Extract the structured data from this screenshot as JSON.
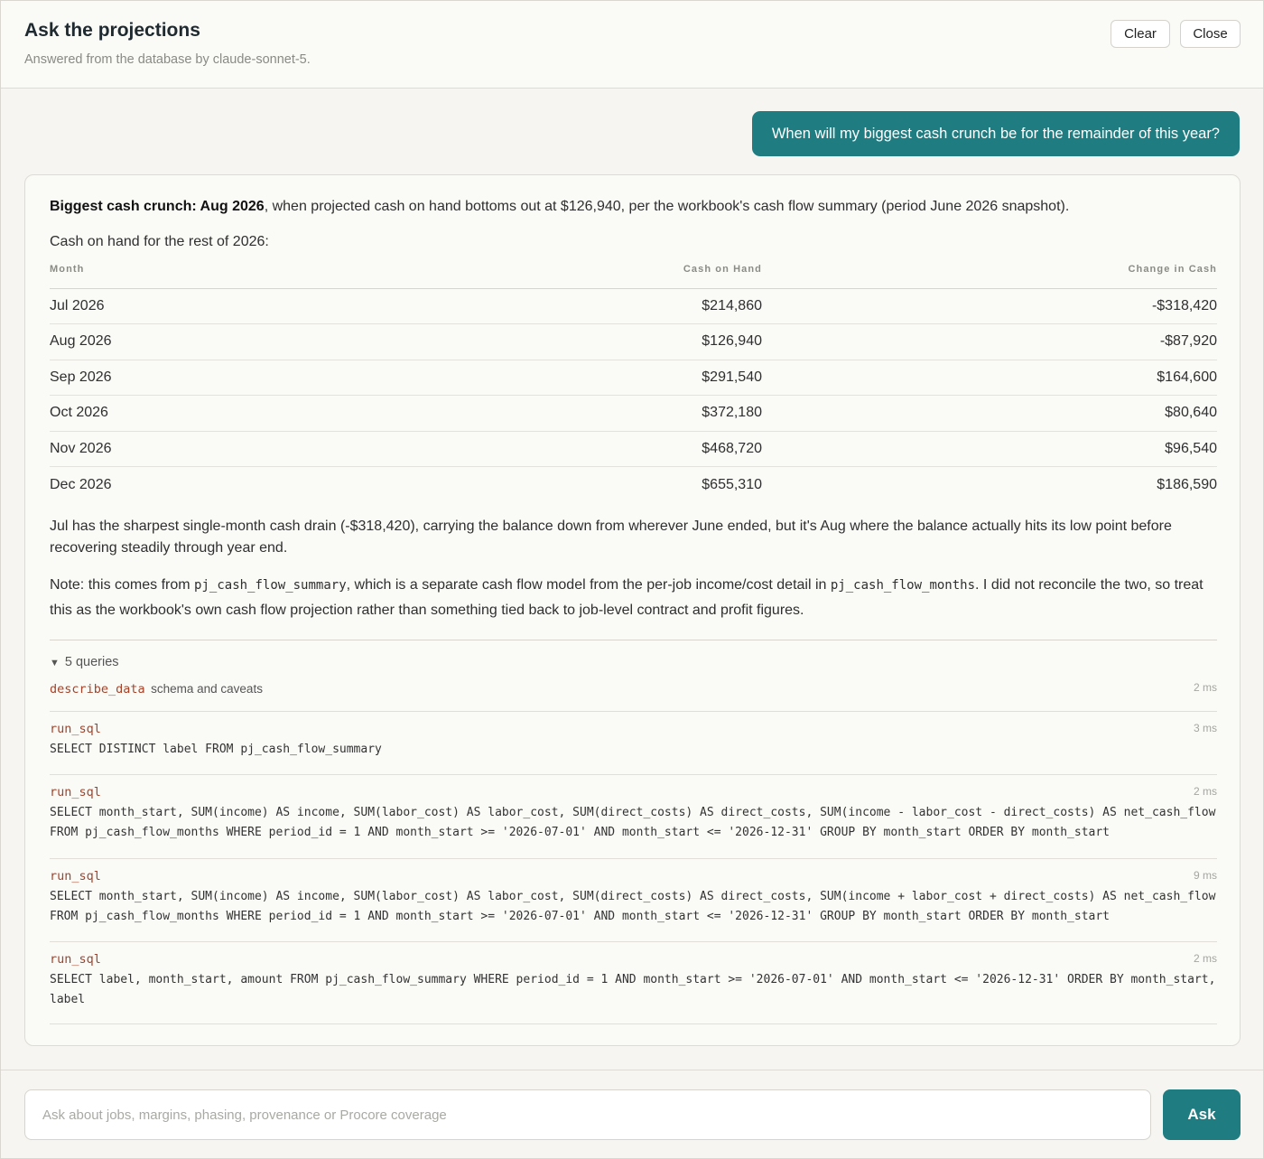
{
  "header": {
    "title": "Ask the projections",
    "subtitle": "Answered from the database by claude-sonnet-5.",
    "clear_label": "Clear",
    "close_label": "Close"
  },
  "user_message": "When will my biggest cash crunch be for the remainder of this year?",
  "answer": {
    "lead_bold": "Biggest cash crunch: Aug 2026",
    "lead_rest": ", when projected cash on hand bottoms out at $126,940, per the workbook's cash flow summary (period June 2026 snapshot).",
    "table_intro": "Cash on hand for the rest of 2026:",
    "table": {
      "headers": [
        "Month",
        "Cash on Hand",
        "Change in Cash"
      ],
      "rows": [
        [
          "Jul 2026",
          "$214,860",
          "-$318,420"
        ],
        [
          "Aug 2026",
          "$126,940",
          "-$87,920"
        ],
        [
          "Sep 2026",
          "$291,540",
          "$164,600"
        ],
        [
          "Oct 2026",
          "$372,180",
          "$80,640"
        ],
        [
          "Nov 2026",
          "$468,720",
          "$96,540"
        ],
        [
          "Dec 2026",
          "$655,310",
          "$186,590"
        ]
      ]
    },
    "para1": "Jul has the sharpest single-month cash drain (-$318,420), carrying the balance down from wherever June ended, but it's Aug where the balance actually hits its low point before recovering steadily through year end.",
    "para2": {
      "a": "Note: this comes from ",
      "code1": "pj_cash_flow_summary",
      "b": ", which is a separate cash flow model from the per-job income/cost detail in ",
      "code2": "pj_cash_flow_months",
      "c": ". I did not reconcile the two, so treat this as the workbook's own cash flow projection rather than something tied back to job-level contract and profit figures."
    }
  },
  "queries": {
    "toggle_label": "5 queries",
    "items": [
      {
        "name": "describe_data",
        "desc": "schema and caveats",
        "time": "2 ms",
        "sql": ""
      },
      {
        "name": "run_sql",
        "desc": "",
        "time": "3 ms",
        "sql": "SELECT DISTINCT label FROM pj_cash_flow_summary"
      },
      {
        "name": "run_sql",
        "desc": "",
        "time": "2 ms",
        "sql": "SELECT month_start, SUM(income) AS income, SUM(labor_cost) AS labor_cost, SUM(direct_costs) AS direct_costs, SUM(income - labor_cost - direct_costs) AS net_cash_flow FROM pj_cash_flow_months WHERE period_id = 1 AND month_start >= '2026-07-01' AND month_start <= '2026-12-31' GROUP BY month_start ORDER BY month_start"
      },
      {
        "name": "run_sql",
        "desc": "",
        "time": "9 ms",
        "sql": "SELECT month_start, SUM(income) AS income, SUM(labor_cost) AS labor_cost, SUM(direct_costs) AS direct_costs, SUM(income + labor_cost + direct_costs) AS net_cash_flow FROM pj_cash_flow_months WHERE period_id = 1 AND month_start >= '2026-07-01' AND month_start <= '2026-12-31' GROUP BY month_start ORDER BY month_start"
      },
      {
        "name": "run_sql",
        "desc": "",
        "time": "2 ms",
        "sql": "SELECT label, month_start, amount FROM pj_cash_flow_summary WHERE period_id = 1 AND month_start >= '2026-07-01' AND month_start <= '2026-12-31' ORDER BY month_start, label"
      }
    ]
  },
  "composer": {
    "placeholder": "Ask about jobs, margins, phasing, provenance or Procore coverage",
    "value": "",
    "ask_label": "Ask"
  },
  "colors": {
    "accent": "#1f7c80",
    "query_name": "#a3442a",
    "background": "#f6f5f1"
  }
}
